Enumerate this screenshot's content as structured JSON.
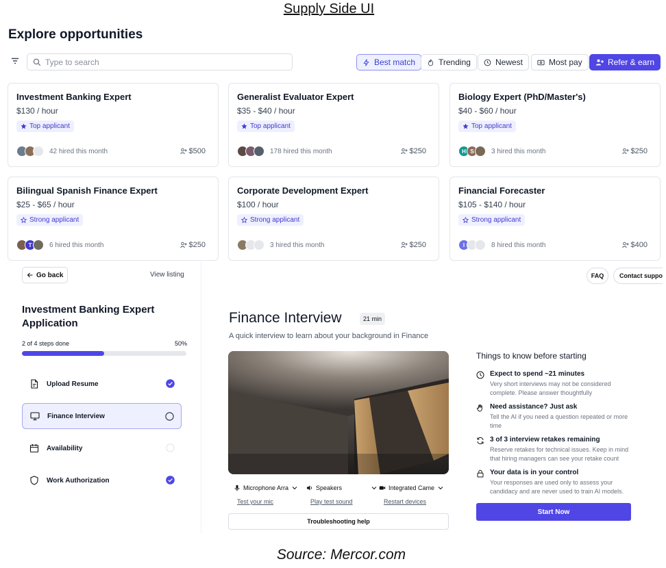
{
  "header": {
    "title": "Supply Side UI"
  },
  "footer": {
    "source": "Source: Mercor.com"
  },
  "explore": {
    "title": "Explore opportunities",
    "search_placeholder": "Type to search",
    "sort": {
      "best_match": "Best match",
      "trending": "Trending",
      "newest": "Newest",
      "most_pay": "Most pay"
    },
    "refer_label": "Refer & earn",
    "cards": [
      {
        "title": "Investment Banking Expert",
        "rate": "$130 / hour",
        "badge": "Top applicant",
        "hired": "42 hired this month",
        "bonus": "$500"
      },
      {
        "title": "Generalist Evaluator Expert",
        "rate": "$35 - $40 / hour",
        "badge": "Top applicant",
        "hired": "178 hired this month",
        "bonus": "$250"
      },
      {
        "title": "Biology Expert (PhD/Master's)",
        "rate": "$40 - $60 / hour",
        "badge": "Top applicant",
        "hired": "3 hired this month",
        "bonus": "$250"
      },
      {
        "title": "Bilingual Spanish Finance Expert",
        "rate": "$25 - $65 / hour",
        "badge": "Strong applicant",
        "hired": "6 hired this month",
        "bonus": "$250"
      },
      {
        "title": "Corporate Development Expert",
        "rate": "$100 / hour",
        "badge": "Strong applicant",
        "hired": "3 hired this month",
        "bonus": "$250"
      },
      {
        "title": "Financial Forecaster",
        "rate": "$105 - $140 / hour",
        "badge": "Strong applicant",
        "hired": "8 hired this month",
        "bonus": "$400"
      }
    ],
    "avatar_initials": {
      "card3_h": "H",
      "card3_s": "S",
      "card4_t": "T",
      "card6_i": "I"
    }
  },
  "application": {
    "go_back": "Go back",
    "view_listing": "View listing",
    "title": "Investment Banking Expert Application",
    "steps_done": "2 of 4 steps done",
    "progress_pct": "50%",
    "progress_value": 0.5,
    "steps": [
      {
        "label": "Upload Resume",
        "status": "done"
      },
      {
        "label": "Finance Interview",
        "status": "current"
      },
      {
        "label": "Availability",
        "status": "pending"
      },
      {
        "label": "Work Authorization",
        "status": "done"
      }
    ]
  },
  "interview": {
    "faq": "FAQ",
    "contact": "Contact support",
    "title": "Finance Interview",
    "duration": "21 min",
    "subtitle": "A quick interview to learn about your background in Finance",
    "devices": {
      "mic": "Microphone Arra",
      "speakers": "Speakers",
      "camera": "Integrated Came",
      "test_mic": "Test your mic",
      "play_test": "Play test sound",
      "restart": "Restart devices"
    },
    "troubleshooting": "Troubleshooting help",
    "know_title": "Things to know before starting",
    "know_items": [
      {
        "title": "Expect to spend ~21 minutes",
        "desc": "Very short interviews may not be considered complete. Please answer thoughtfully"
      },
      {
        "title": "Need assistance? Just ask",
        "desc": "Tell the AI if you need a question repeated or more time"
      },
      {
        "title": "3 of 3 interview retakes remaining",
        "desc": "Reserve retakes for technical issues. Keep in mind that hiring managers can see your retake count"
      },
      {
        "title": "Your data is in your control",
        "desc": "Your responses are used only to assess your candidacy and are never used to train AI models."
      }
    ],
    "start": "Start Now"
  },
  "colors": {
    "accent": "#4f46e5",
    "accent_light": "#eef0ff",
    "border": "#e3e5ea"
  }
}
